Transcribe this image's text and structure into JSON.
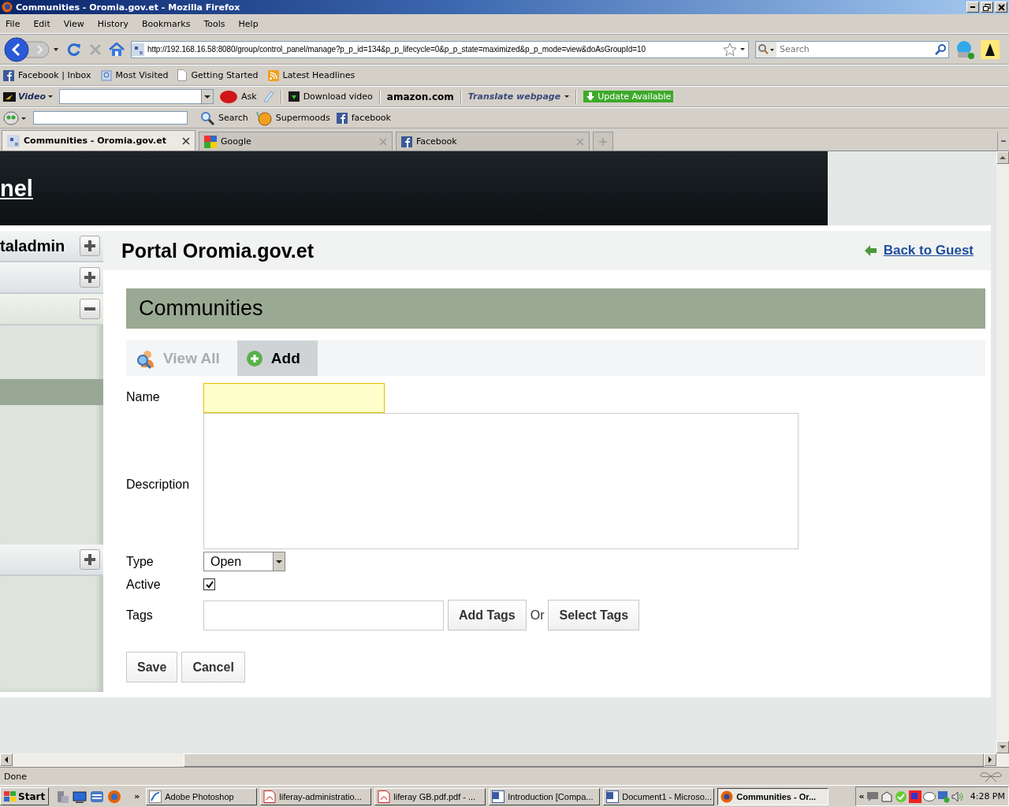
{
  "window": {
    "title": "Communities - Oromia.gov.et - Mozilla Firefox"
  },
  "menu": [
    "File",
    "Edit",
    "View",
    "History",
    "Bookmarks",
    "Tools",
    "Help"
  ],
  "nav": {
    "url": "http://192.168.16.58:8080/group/control_panel/manage?p_p_id=134&p_p_lifecycle=0&p_p_state=maximized&p_p_mode=view&doAsGroupId=10",
    "search_placeholder": "Search"
  },
  "bookmarks": [
    "Facebook | Inbox",
    "Most Visited",
    "Getting Started",
    "Latest Headlines"
  ],
  "toolbar": {
    "video_label": "Video",
    "ask": "Ask",
    "download": "Download video",
    "amazon": "amazon.com",
    "translate": "Translate webpage",
    "update": "Update Available"
  },
  "toolbar2": {
    "search": "Search",
    "supermoods": "Supermoods",
    "facebook": "facebook"
  },
  "tabs": [
    {
      "label": "Communities - Oromia.gov.et",
      "selected": true
    },
    {
      "label": "Google",
      "selected": false
    },
    {
      "label": "Facebook",
      "selected": false
    }
  ],
  "page": {
    "header_link": "nel",
    "sidebar": [
      {
        "label": "taladmin",
        "expanded": false
      },
      {
        "expanded": false
      },
      {
        "expanded": true,
        "items": [
          {
            "selected": true
          }
        ]
      },
      {
        "expanded": false
      }
    ],
    "portal_title": "Portal Oromia.gov.et",
    "back_link": "Back to Guest",
    "portlet_title": "Communities",
    "portlet_tabs": [
      {
        "label": "View All",
        "selected": false
      },
      {
        "label": "Add",
        "selected": true
      }
    ],
    "form": {
      "name_label": "Name",
      "name_focused": true,
      "description_label": "Description",
      "type_label": "Type",
      "type_value": "Open",
      "active_label": "Active",
      "active_checked": true,
      "tags_label": "Tags",
      "add_tags": "Add Tags",
      "or": "Or",
      "select_tags": "Select Tags",
      "save": "Save",
      "cancel": "Cancel"
    }
  },
  "status": "Done",
  "taskbar": {
    "start": "Start",
    "more": "»",
    "tasks": [
      {
        "label": "Adobe Photoshop",
        "kind": "photoshop",
        "selected": false
      },
      {
        "label": "liferay-administratio...",
        "kind": "pdf",
        "selected": false
      },
      {
        "label": "liferay GB.pdf.pdf - ...",
        "kind": "pdf",
        "selected": false
      },
      {
        "label": "Introduction [Compa...",
        "kind": "word",
        "selected": false
      },
      {
        "label": "Document1 - Microso...",
        "kind": "word",
        "selected": false
      },
      {
        "label": "Communities - Or...",
        "kind": "firefox",
        "selected": true
      }
    ],
    "tray_more": "«",
    "clock": "4:28 PM"
  }
}
